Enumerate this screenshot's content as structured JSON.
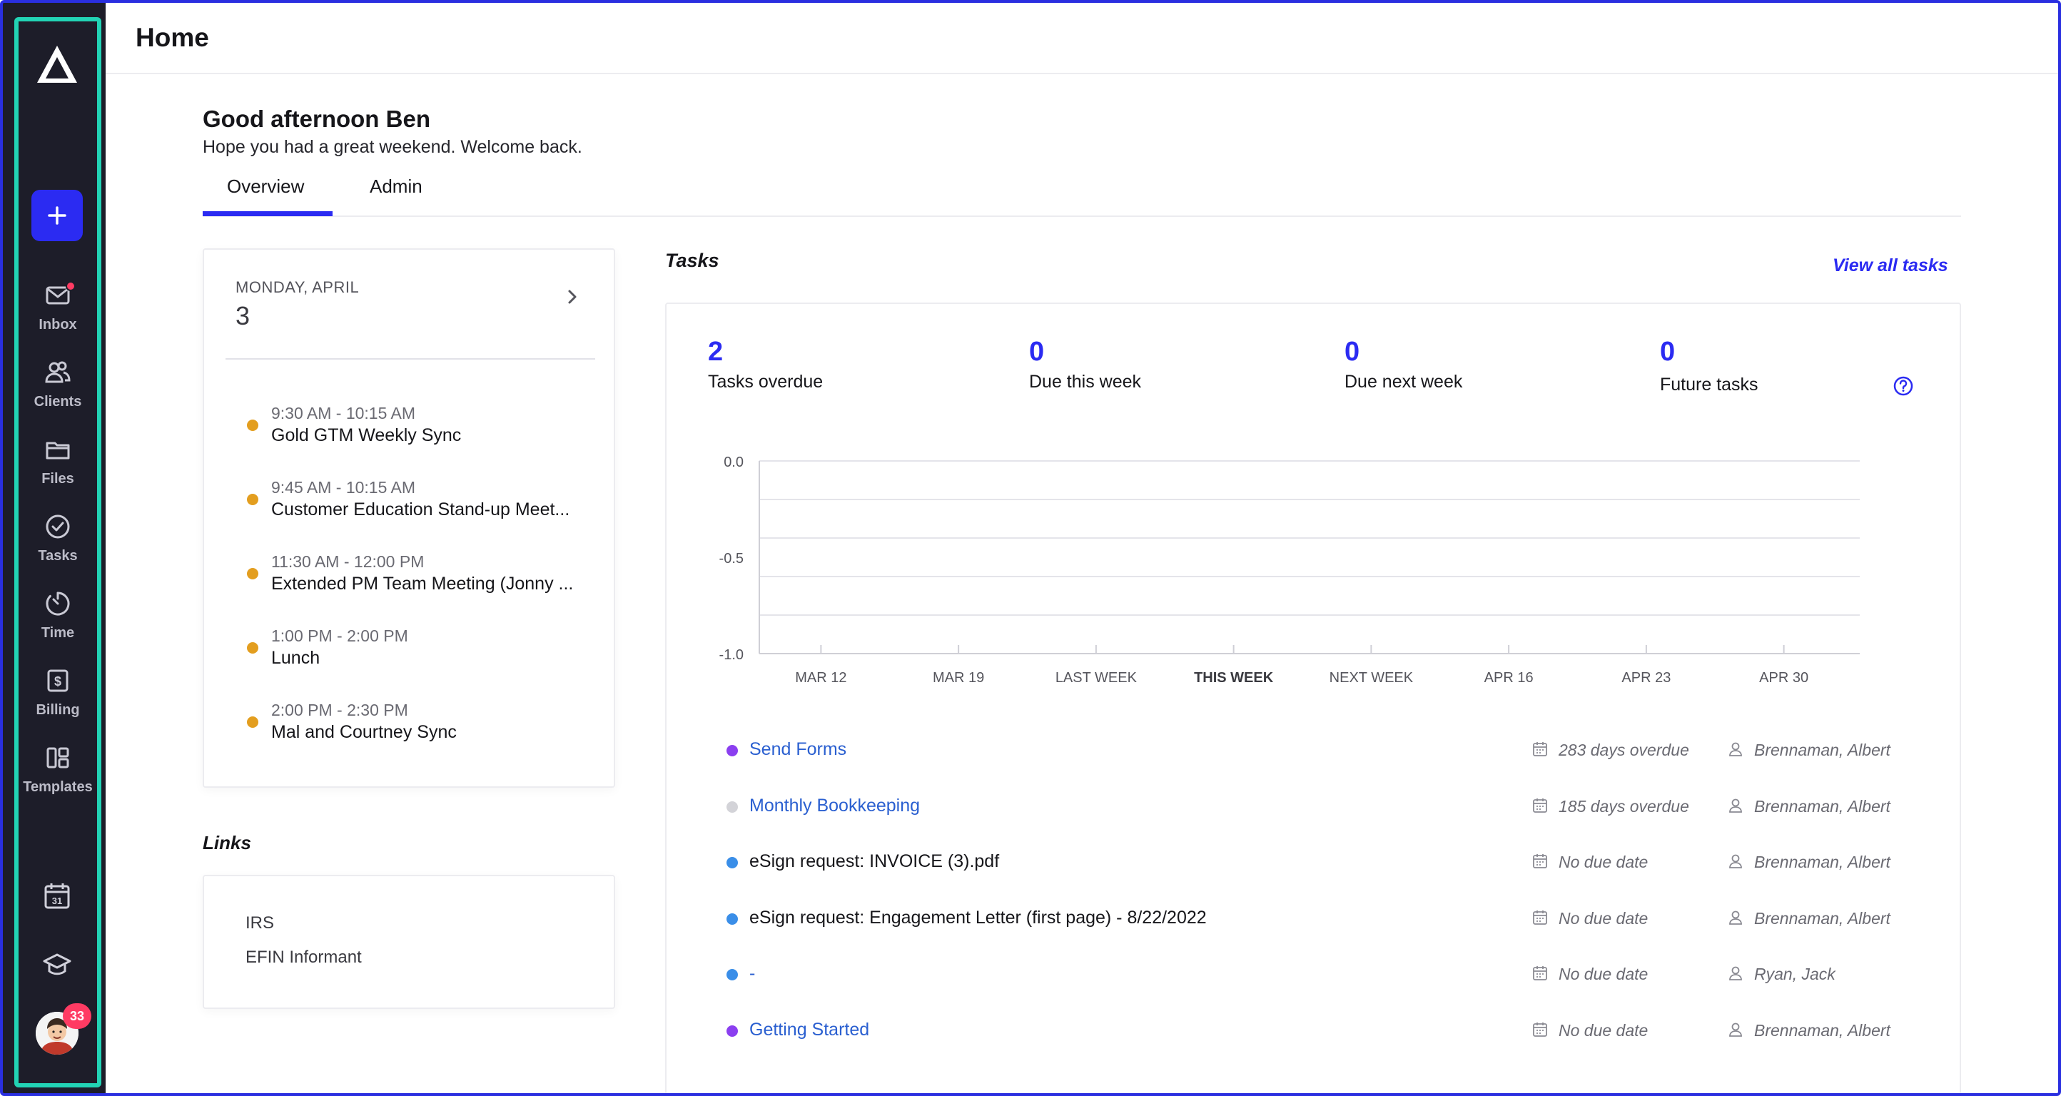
{
  "header": {
    "title": "Home"
  },
  "sidebar": {
    "items": [
      {
        "label": "Inbox",
        "icon": "mail-icon",
        "has_dot": true
      },
      {
        "label": "Clients",
        "icon": "users-icon"
      },
      {
        "label": "Files",
        "icon": "folder-icon"
      },
      {
        "label": "Tasks",
        "icon": "check-circle-icon"
      },
      {
        "label": "Time",
        "icon": "timer-icon"
      },
      {
        "label": "Billing",
        "icon": "dollar-icon"
      },
      {
        "label": "Templates",
        "icon": "layout-icon"
      }
    ],
    "notification_count": "33",
    "accent": "#2b2bf2",
    "outline_color": "#22d3b5"
  },
  "welcome": {
    "greeting": "Good afternoon Ben",
    "subtitle": "Hope you had a great weekend. Welcome back."
  },
  "tabs": [
    {
      "label": "Overview",
      "active": true
    },
    {
      "label": "Admin",
      "active": false
    }
  ],
  "calendar": {
    "day_label": "MONDAY, APRIL",
    "date": "3",
    "events": [
      {
        "time": "9:30 AM - 10:15 AM",
        "title": "Gold GTM Weekly Sync"
      },
      {
        "time": "9:45 AM - 10:15 AM",
        "title": "Customer Education Stand-up Meet..."
      },
      {
        "time": "11:30 AM - 12:00 PM",
        "title": "Extended PM Team Meeting (Jonny ..."
      },
      {
        "time": "1:00 PM - 2:00 PM",
        "title": "Lunch"
      },
      {
        "time": "2:00 PM - 2:30 PM",
        "title": "Mal and Courtney Sync"
      }
    ]
  },
  "links": {
    "heading": "Links",
    "items": [
      "IRS",
      "EFIN Informant"
    ]
  },
  "tasks": {
    "heading": "Tasks",
    "view_all": "View all tasks",
    "stats": [
      {
        "value": "2",
        "label": "Tasks overdue"
      },
      {
        "value": "0",
        "label": "Due this week"
      },
      {
        "value": "0",
        "label": "Due next week"
      },
      {
        "value": "0",
        "label": "Future tasks"
      }
    ],
    "rows": [
      {
        "name": "Send Forms",
        "link": true,
        "dot_color": "#8b3ff0",
        "due": "283 days overdue",
        "assignee": "Brennaman, Albert"
      },
      {
        "name": "Monthly Bookkeeping",
        "link": true,
        "dot_color": "#d3d3d8",
        "due": "185 days overdue",
        "assignee": "Brennaman, Albert"
      },
      {
        "name": "eSign request: INVOICE (3).pdf",
        "link": false,
        "dot_color": "#3a8ee8",
        "due": "No due date",
        "assignee": "Brennaman, Albert"
      },
      {
        "name": "eSign request: Engagement Letter (first page) - 8/22/2022",
        "link": false,
        "dot_color": "#3a8ee8",
        "due": "No due date",
        "assignee": "Brennaman, Albert"
      },
      {
        "name": "-",
        "link": true,
        "dot_color": "#3a8ee8",
        "due": "No due date",
        "assignee": "Ryan, Jack"
      },
      {
        "name": "Getting Started",
        "link": true,
        "dot_color": "#8b3ff0",
        "due": "No due date",
        "assignee": "Brennaman, Albert"
      }
    ]
  },
  "chart_data": {
    "type": "bar",
    "categories": [
      "MAR 12",
      "MAR 19",
      "LAST WEEK",
      "THIS WEEK",
      "NEXT WEEK",
      "APR 16",
      "APR 23",
      "APR 30"
    ],
    "highlight_category": "THIS WEEK",
    "values": [
      0,
      0,
      0,
      0,
      0,
      0,
      0,
      0
    ],
    "yticks": [
      "0.0",
      "-0.5",
      "-1.0"
    ],
    "ylim": [
      -1.0,
      0.0
    ],
    "grid": true
  }
}
